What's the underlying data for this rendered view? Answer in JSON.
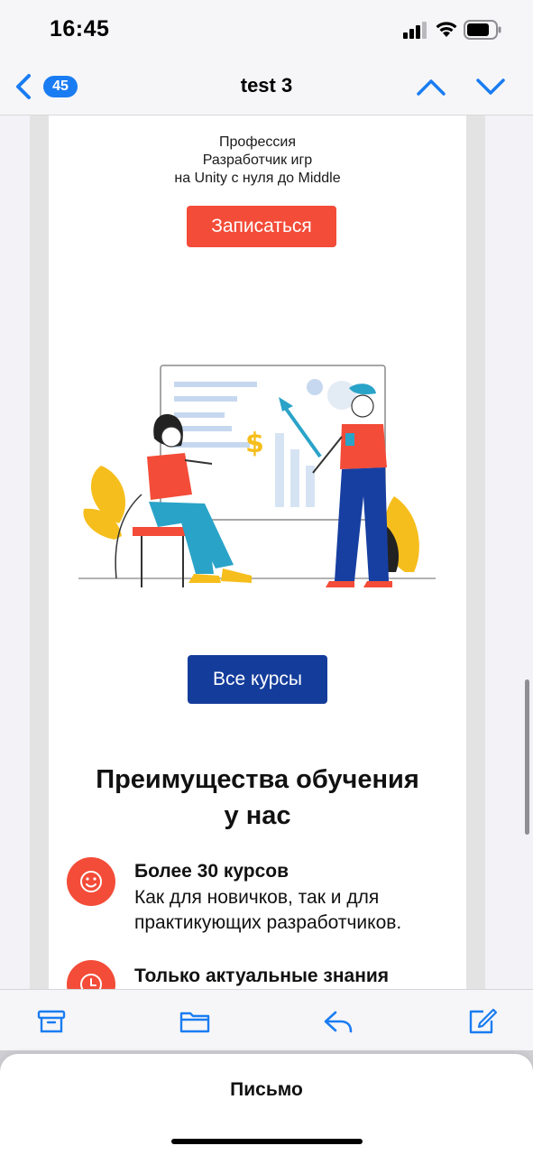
{
  "status_bar": {
    "time": "16:45",
    "icons": [
      "cellular-signal-icon",
      "wifi-icon",
      "battery-icon"
    ]
  },
  "nav": {
    "title": "test 3",
    "unread_count": "45",
    "icons": [
      "back-chevron-icon",
      "chevron-up-icon",
      "chevron-down-icon"
    ],
    "accent_color": "#1a7cf2"
  },
  "email": {
    "hero": {
      "lines": [
        "Профессия",
        "Разработчик игр",
        "на Unity с нуля до Middle"
      ],
      "signup_button": "Записаться",
      "signup_color": "#f34c38"
    },
    "courses_button": "Все курсы",
    "courses_color": "#143c9b",
    "benefits": {
      "title_lines": [
        "Преимущества обучения",
        "у нас"
      ],
      "items": [
        {
          "icon": "smiley-icon",
          "heading": "Более 30 курсов",
          "lines": [
            "Как для новичков, так и для",
            "практикующих разработчиков."
          ]
        },
        {
          "icon": "clock-icon",
          "heading": "Только актуальные знания",
          "lines": []
        }
      ]
    }
  },
  "toolbar": {
    "icons": [
      "archive-icon",
      "folder-icon",
      "reply-icon",
      "compose-icon"
    ]
  },
  "bottom_sheet": {
    "title": "Письмо"
  }
}
